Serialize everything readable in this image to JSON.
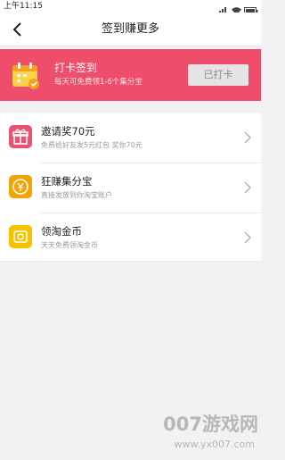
{
  "status_bar": {
    "time": "上午11:15"
  },
  "header": {
    "title": "签到赚更多"
  },
  "checkin": {
    "title": "打卡签到",
    "subtitle": "每天可免费领1-6个集分宝",
    "button_label": "已打卡"
  },
  "list": [
    {
      "name": "邀请奖70元",
      "desc": "免费给好友发5元红包 奖你70元",
      "icon": "gift-icon",
      "color": "#e9536e"
    },
    {
      "name": "狂赚集分宝",
      "desc": "直接发放到你淘宝账户",
      "icon": "jifenbao-coin-icon",
      "color": "#f2a400"
    },
    {
      "name": "领淘金币",
      "desc": "天天免费领淘金币",
      "icon": "taojinbi-coin-icon",
      "color": "#f4c200"
    }
  ],
  "watermark": {
    "line1": "007游戏网",
    "line2": "www.yx007.com"
  },
  "colors": {
    "banner": "#ee4d6b",
    "background": "#f2f2f4"
  }
}
